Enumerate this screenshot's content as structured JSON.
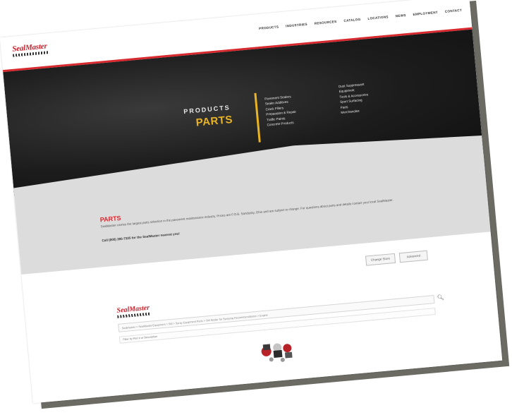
{
  "brand": {
    "name": "SealMaster",
    "accent_color": "#d8292f",
    "gold_color": "#e9b323"
  },
  "nav": {
    "items": [
      "PRODUCTS",
      "INDUSTRIES",
      "RESOURCES",
      "CATALOG",
      "LOCATIONS",
      "NEWS",
      "EMPLOYMENT",
      "CONTACT"
    ]
  },
  "hero": {
    "eyebrow": "PRODUCTS",
    "title": "PARTS",
    "menu_left": [
      "Pavement Sealers",
      "Sealer Additives",
      "Crack Fillers",
      "Preparation & Repair",
      "Traffic Paints",
      "Concrete Products"
    ],
    "menu_right": [
      "Dust Suppressant",
      "Equipment",
      "Tools & Accessories",
      "Sport Surfacing",
      "Parts",
      "Merchandise"
    ]
  },
  "intro": {
    "title": "PARTS",
    "text": "SealMaster carries the largest parts selection in the pavement maintenance industry. Prices are F.O.B. Sandusky, Ohio and are subject to change. For questions about parts and details contact your local SealMaster.",
    "call": "Call (800) 395-7325 for the SealMaster nearest you!"
  },
  "actions": {
    "btn1": "Change Store",
    "btn2": "Advanced"
  },
  "catalog": {
    "breadcrumb": "Sealmaster  >  SealMaster/Equipment  >  SM  >  Spray Equipment Parts  >  SM Sealer for Spraying Recommendations  >  Engine",
    "filter_placeholder": "Filter by Part # or Description",
    "search_icon": "search-icon"
  }
}
